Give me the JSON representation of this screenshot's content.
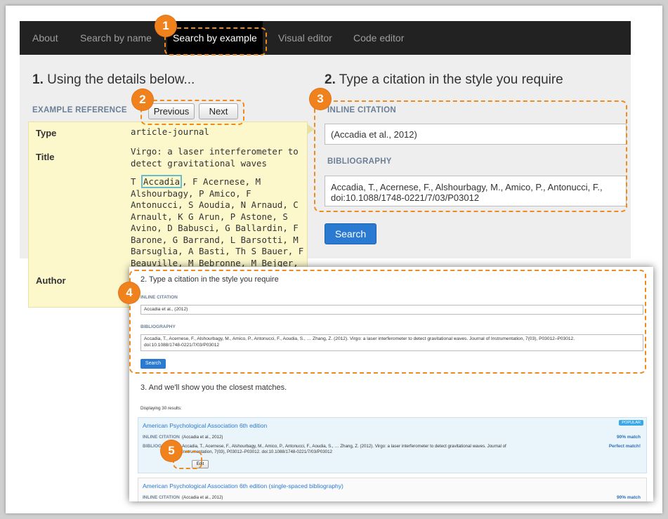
{
  "nav": {
    "items": [
      {
        "label": "About"
      },
      {
        "label": "Search by name"
      },
      {
        "label": "Search by example"
      },
      {
        "label": "Visual editor"
      },
      {
        "label": "Code editor"
      }
    ]
  },
  "left": {
    "heading_num": "1.",
    "heading_text": " Using the details below...",
    "example_label": "EXAMPLE REFERENCE",
    "prev_label": "Previous",
    "next_label": "Next",
    "type_key": "Type",
    "type_val": "article-journal",
    "title_key": "Title",
    "title_val": "Virgo: a laser interferometer to detect gravitational waves",
    "author_key": "Author",
    "author_first": "T ",
    "author_highlight": "Accadia",
    "author_rest": ", F Acernese, M Alshourbagy, P Amico, F Antonucci, S Aoudia, N Arnaud, C Arnault, K G Arun, P Astone, S Avino, D Babusci, G Ballardin, F Barone, G Barrand, L Barsotti, M Barsuglia, A Basti, Th S Bauer, F Beauville, M Bebronne, M Bejger, M G Beker, F Bellachia"
  },
  "right": {
    "heading_num": "2.",
    "heading_text": " Type a citation in the style you require",
    "inline_label": "INLINE CITATION",
    "inline_value": "(Accadia et al., 2012)",
    "bib_label": "BIBLIOGRAPHY",
    "bib_value": "Accadia, T., Acernese, F., Alshourbagy, M., Amico, P., Antonucci, F., doi:10.1088/1748-0221/7/03/P03012",
    "search_label": "Search"
  },
  "callouts": [
    "1",
    "2",
    "3",
    "4",
    "5"
  ],
  "overlay": {
    "heading": "2. Type a citation in the style you require",
    "inline_label": "INLINE CITATION",
    "inline_value": "Accadia et al., (2012)",
    "bib_label": "BIBLIOGRAPHY",
    "bib_line1": "Accadia, T., Acernese, F., Alshourbagy, M., Amico, P., Antonucci, F., Aoudia, S., … Zhang, Z. (2012). Virgo: a laser interferometer to detect gravitational waves. Journal of Instrumentation, 7(03), P03012–P03012.",
    "bib_line2": "doi:10.1088/1748-0221/7/03/P03012",
    "search_label": "Search",
    "step3": "3. And we'll show you the closest matches.",
    "results_count": "Displaying 30 results:",
    "results": [
      {
        "title": "American Psychological Association 6th edition",
        "badge": "POPULAR",
        "inline_label": "INLINE CITATION",
        "inline_value": "(Accadia et al., 2012)",
        "inline_match": "90% match",
        "bib_label": "BIBLIOGRAPHY",
        "bib_line1": "Accadia, T., Acernese, F., Alshourbagy, M., Amico, P., Antonucci, F., Aoudia, S., … Zhang, Z. (2012). Virgo: a laser interferometer to detect gravitational waves. Journal of",
        "bib_line2": "Instrumentation, 7(03), P03012–P03012. doi:10.1088/1748-0221/7/03/P03012",
        "bib_match": "Perfect match!",
        "edit_label": "Edit"
      },
      {
        "title": "American Psychological Association 6th edition (single-spaced bibliography)",
        "inline_label": "INLINE CITATION",
        "inline_value": "(Accadia et al., 2012)",
        "inline_match": "90% match"
      }
    ]
  },
  "colors": {
    "accent_orange": "#f0821e",
    "nav_bg": "#222222",
    "link_blue": "#2a7ad2",
    "example_panel_bg": "#fcf8cc"
  }
}
